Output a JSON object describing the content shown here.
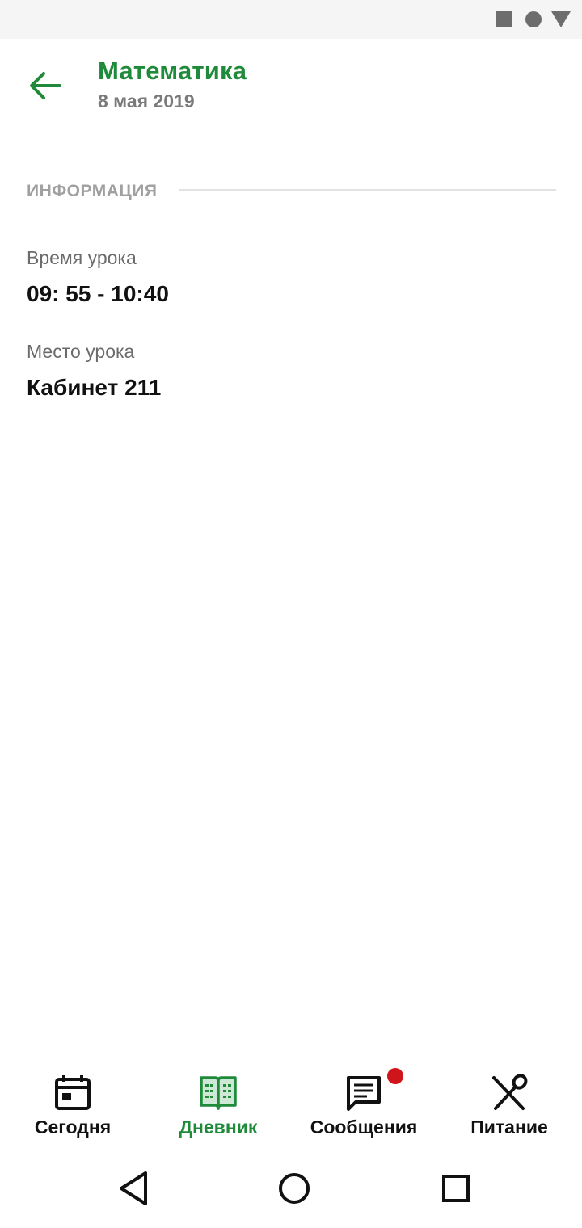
{
  "colors": {
    "accent": "#1f8a3a",
    "badge": "#d0141b",
    "muted": "#7a7a7a"
  },
  "header": {
    "title": "Математика",
    "subtitle": "8 мая 2019",
    "back_icon": "arrow-left-icon"
  },
  "section": {
    "label": "ИНФОРМАЦИЯ"
  },
  "fields": [
    {
      "label": "Время урока",
      "value": "09: 55 - 10:40"
    },
    {
      "label": "Место урока",
      "value": "Кабинет 211"
    }
  ],
  "bottom_nav": {
    "items": [
      {
        "label": "Сегодня",
        "icon": "calendar-icon",
        "active": false
      },
      {
        "label": "Дневник",
        "icon": "diary-book-icon",
        "active": true
      },
      {
        "label": "Сообщения",
        "icon": "messages-icon",
        "active": false,
        "has_badge": true
      },
      {
        "label": "Питание",
        "icon": "food-icon",
        "active": false
      }
    ]
  },
  "system_nav": {
    "back": "back-triangle-icon",
    "home": "home-circle-icon",
    "recents": "recents-square-icon"
  }
}
